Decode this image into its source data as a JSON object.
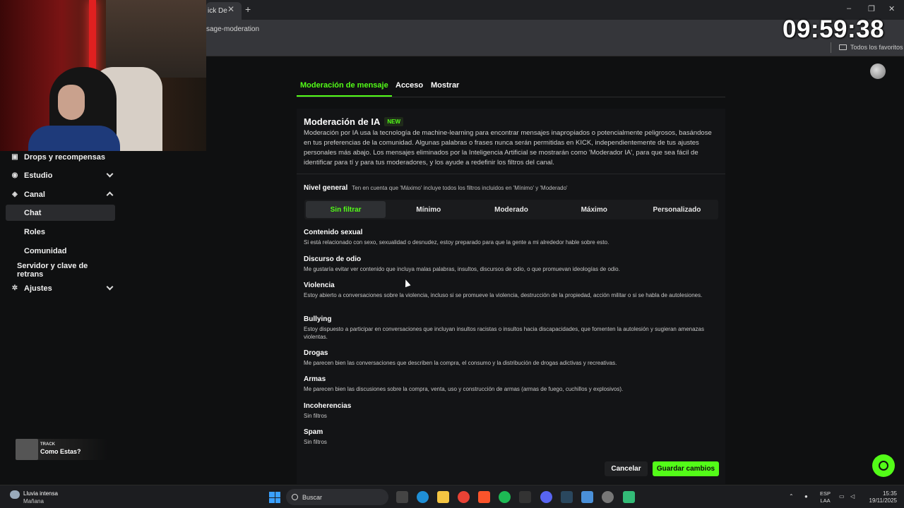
{
  "browser": {
    "tab_label": "ick De",
    "tab_close": "✕",
    "new_tab": "+",
    "url": "sage-moderation",
    "bookmarks_folder": "Todos los favoritos",
    "window_minimize": "–",
    "window_maximize": "❐",
    "window_close": "✕"
  },
  "overlay_clock": "09:59:38",
  "sidebar": {
    "items": [
      {
        "label": "Drops y recompensas",
        "icon": "gift-icon"
      },
      {
        "label": "Estudio",
        "icon": "studio-icon"
      },
      {
        "label": "Canal",
        "icon": "channel-icon"
      }
    ],
    "sub_items": [
      "Chat",
      "Roles",
      "Comunidad"
    ],
    "stream_key": "Servidor y clave de retrans",
    "settings": "Ajustes"
  },
  "music": {
    "tag": "TRACK",
    "title": "Como Estas?"
  },
  "tabs": [
    "Moderación de mensaje",
    "Acceso",
    "Mostrar"
  ],
  "panel": {
    "title": "Moderación de IA",
    "badge": "NEW",
    "description": "Moderación por IA usa la tecnología de machine-learning para encontrar mensajes inapropiados o potencialmente peligrosos, basándose en tus preferencias de la comunidad. Algunas palabras o frases nunca serán permitidas en KICK, independientemente de tus ajustes personales más abajo. Los mensajes eliminados por la Inteligencia Artificial se mostrarán como 'Moderador IA', para que sea fácil de identificar para tí y para tus moderadores, y los ayude a redefinir los filtros del canal.",
    "level_label": "Nivel general",
    "level_hint": "Ten en cuenta que 'Máximo' incluye todos los filtros incluidos en 'Mínimo' y 'Moderado'",
    "levels": [
      "Sin filtrar",
      "Mínimo",
      "Moderado",
      "Máximo",
      "Personalizado"
    ],
    "selected_level": "Sin filtrar",
    "filters": [
      {
        "title": "Contenido sexual",
        "desc": "Si está relacionado con sexo, sexualidad o desnudez, estoy preparado para que la gente a mi alrededor hable sobre esto."
      },
      {
        "title": "Discurso de odio",
        "desc": "Me gustaría evitar ver contenido que incluya malas palabras, insultos, discursos de odio, o que promuevan ideologías de odio."
      },
      {
        "title": "Violencia",
        "desc": "Estoy abierto a conversaciones sobre la violencia, incluso si se promueve la violencia, destrucción de la propiedad, acción militar o si se habla de autolesiones."
      },
      {
        "title": "Bullying",
        "desc": "Estoy dispuesto a participar en conversaciones que incluyan insultos racistas o insultos hacia discapacidades, que fomenten la autolesión y sugieran amenazas violentas."
      },
      {
        "title": "Drogas",
        "desc": "Me parecen bien las conversaciones que describen la compra, el consumo y la distribución de drogas adictivas y recreativas."
      },
      {
        "title": "Armas",
        "desc": "Me parecen bien las discusiones sobre la compra, venta, uso y construcción de armas (armas de fuego, cuchillos y explosivos)."
      },
      {
        "title": "Incoherencias",
        "desc": "Sin filtros"
      },
      {
        "title": "Spam",
        "desc": "Sin filtros"
      }
    ]
  },
  "actions": {
    "cancel": "Cancelar",
    "save": "Guardar cambios"
  },
  "taskbar": {
    "weather": "Lluvia intensa",
    "weather_sub": "Mañana",
    "search": "Buscar",
    "lang_1": "ESP",
    "lang_2": "LAA",
    "time": "15:35",
    "date": "19/11/2025"
  },
  "colors": {
    "accent": "#53fc18",
    "background": "#0f1011",
    "panel": "#131416"
  }
}
